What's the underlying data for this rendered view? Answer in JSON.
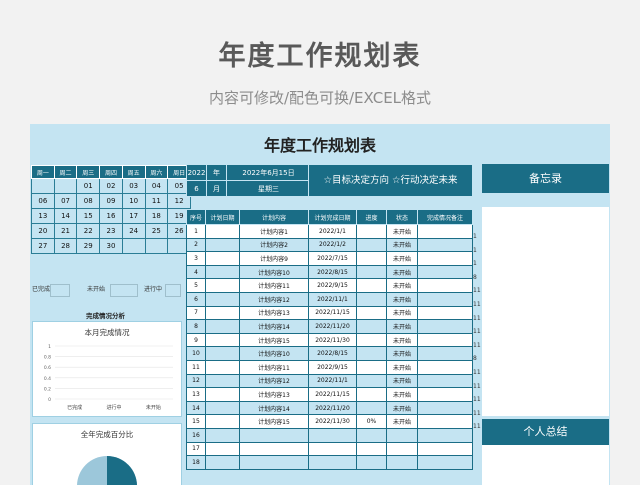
{
  "header": {
    "title": "年度工作规划表",
    "subtitle": "内容可修改/配色可换/EXCEL格式"
  },
  "sheet": {
    "title": "年度工作规划表"
  },
  "calendar": {
    "weekdays": [
      "周一",
      "周二",
      "周三",
      "周四",
      "周五",
      "周六",
      "周日"
    ],
    "weeks": [
      [
        "",
        "",
        "01",
        "02",
        "03",
        "04",
        "05"
      ],
      [
        "06",
        "07",
        "08",
        "09",
        "10",
        "11",
        "12"
      ],
      [
        "13",
        "14",
        "15",
        "16",
        "17",
        "18",
        "19"
      ],
      [
        "20",
        "21",
        "22",
        "23",
        "24",
        "25",
        "26"
      ],
      [
        "27",
        "28",
        "29",
        "30",
        "",
        "",
        ""
      ]
    ]
  },
  "status_strip": {
    "done": "已完成",
    "not_started": "未开始",
    "in_progress": "进行中"
  },
  "analysis": {
    "title": "完成情况分析",
    "monthly_title": "本月完成情况",
    "yearly_title": "全年完成百分比"
  },
  "chart_data": {
    "type": "bar",
    "title": "本月完成情况",
    "categories": [
      "已完成",
      "进行中",
      "未开始"
    ],
    "values": [
      0,
      0,
      0
    ],
    "yticks": [
      "1",
      "0.8",
      "0.6",
      "0.4",
      "0.2",
      "0"
    ],
    "ylim": [
      0,
      1
    ],
    "xlabel": "",
    "ylabel": "",
    "grid": true
  },
  "date_box": {
    "year": "2022",
    "year_label": "年",
    "date": "2022年6月15日",
    "month": "6",
    "month_label": "月",
    "weekday": "星期三"
  },
  "motto": "☆目标决定方向 ☆行动决定未来",
  "tasks": {
    "headers": [
      "序号",
      "计划日期",
      "计划内容",
      "计划完成日期",
      "进度",
      "状态",
      "完成情况备注"
    ],
    "rows": [
      [
        "1",
        "",
        "计划内容1",
        "2022/1/1",
        "",
        "未开始",
        ""
      ],
      [
        "2",
        "",
        "计划内容2",
        "2022/1/2",
        "",
        "未开始",
        ""
      ],
      [
        "3",
        "",
        "计划内容9",
        "2022/7/15",
        "",
        "未开始",
        ""
      ],
      [
        "4",
        "",
        "计划内容10",
        "2022/8/15",
        "",
        "未开始",
        ""
      ],
      [
        "5",
        "",
        "计划内容11",
        "2022/9/15",
        "",
        "未开始",
        ""
      ],
      [
        "6",
        "",
        "计划内容12",
        "2022/11/1",
        "",
        "未开始",
        ""
      ],
      [
        "7",
        "",
        "计划内容13",
        "2022/11/15",
        "",
        "未开始",
        ""
      ],
      [
        "8",
        "",
        "计划内容14",
        "2022/11/20",
        "",
        "未开始",
        ""
      ],
      [
        "9",
        "",
        "计划内容15",
        "2022/11/30",
        "",
        "未开始",
        ""
      ],
      [
        "10",
        "",
        "计划内容10",
        "2022/8/15",
        "",
        "未开始",
        ""
      ],
      [
        "11",
        "",
        "计划内容11",
        "2022/9/15",
        "",
        "未开始",
        ""
      ],
      [
        "12",
        "",
        "计划内容12",
        "2022/11/1",
        "",
        "未开始",
        ""
      ],
      [
        "13",
        "",
        "计划内容13",
        "2022/11/15",
        "",
        "未开始",
        ""
      ],
      [
        "14",
        "",
        "计划内容14",
        "2022/11/20",
        "",
        "未开始",
        ""
      ],
      [
        "15",
        "",
        "计划内容15",
        "2022/11/30",
        "0%",
        "未开始",
        ""
      ],
      [
        "16",
        "",
        "",
        "",
        "",
        "",
        ""
      ],
      [
        "17",
        "",
        "",
        "",
        "",
        "",
        ""
      ],
      [
        "18",
        "",
        "",
        "",
        "",
        "",
        ""
      ]
    ]
  },
  "right_strip": [
    "1",
    "1",
    "1",
    "8",
    "11",
    "11",
    "11",
    "11",
    "11",
    "8",
    "11",
    "11",
    "11",
    "11",
    "11"
  ],
  "memo": {
    "title": "备忘录"
  },
  "summary": {
    "title": "个人总结"
  },
  "colors": {
    "dark": "#1a6d86",
    "light": "#c4e4f2",
    "pie": "#9cc7da"
  }
}
